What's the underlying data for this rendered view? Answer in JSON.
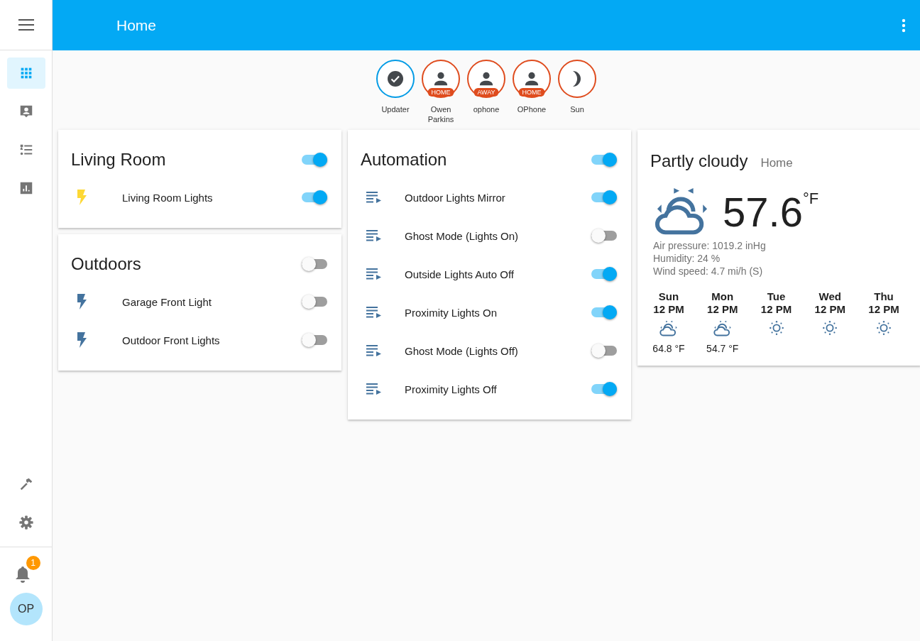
{
  "toolbar": {
    "title": "Home"
  },
  "sidebar": {
    "items": [
      {
        "selected": true
      },
      {
        "selected": false
      },
      {
        "selected": false
      },
      {
        "selected": false
      }
    ],
    "notifications": {
      "count": "1"
    },
    "user": {
      "initials": "OP"
    }
  },
  "badges": [
    {
      "kind": "check",
      "label": "Updater",
      "color": "#039be5"
    },
    {
      "kind": "person",
      "label": "Owen Parkins",
      "tag": "HOME",
      "color": "#df4c1e"
    },
    {
      "kind": "person",
      "label": "ophone",
      "tag": "AWAY",
      "color": "#df4c1e"
    },
    {
      "kind": "person",
      "label": "OPhone",
      "tag": "HOME",
      "color": "#df4c1e"
    },
    {
      "kind": "moon",
      "label": "Sun",
      "color": "#df4c1e"
    }
  ],
  "columns": [
    [
      {
        "title": "Living Room",
        "on": true,
        "entities": [
          {
            "kind": "light",
            "name": "Living Room Lights",
            "on": true
          }
        ]
      },
      {
        "title": "Outdoors",
        "on": false,
        "entities": [
          {
            "kind": "light",
            "name": "Garage Front Light",
            "on": false
          },
          {
            "kind": "light",
            "name": "Outdoor Front Lights",
            "on": false
          }
        ]
      }
    ],
    [
      {
        "title": "Automation",
        "on": true,
        "entities": [
          {
            "kind": "automation",
            "name": "Outdoor Lights Mirror",
            "on": true
          },
          {
            "kind": "automation",
            "name": "Ghost Mode (Lights On)",
            "on": false
          },
          {
            "kind": "automation",
            "name": "Outside Lights Auto Off",
            "on": true
          },
          {
            "kind": "automation",
            "name": "Proximity Lights On",
            "on": true
          },
          {
            "kind": "automation",
            "name": "Ghost Mode (Lights Off)",
            "on": false
          },
          {
            "kind": "automation",
            "name": "Proximity Lights Off",
            "on": true
          }
        ]
      }
    ]
  ],
  "weather": {
    "condition": "Partly cloudy",
    "location": "Home",
    "kind": "partlycloudy",
    "temperature": "57.6",
    "unit": "°F",
    "details": [
      "Air pressure: 1019.2 inHg",
      "Humidity: 24 %",
      "Wind speed: 4.7 mi/h (S)"
    ],
    "forecast": [
      {
        "day": "Sun",
        "time": "12 PM",
        "kind": "partlycloudy",
        "temp": "64.8 °F"
      },
      {
        "day": "Mon",
        "time": "12 PM",
        "kind": "partlycloudy",
        "temp": "54.7 °F"
      },
      {
        "day": "Tue",
        "time": "12 PM",
        "kind": "sunny"
      },
      {
        "day": "Wed",
        "time": "12 PM",
        "kind": "sunny"
      },
      {
        "day": "Thu",
        "time": "12 PM",
        "kind": "sunny"
      }
    ]
  }
}
